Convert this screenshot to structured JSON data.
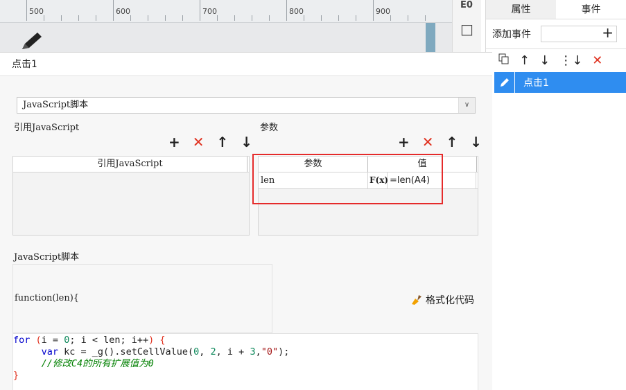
{
  "ruler": {
    "labels": [
      "500",
      "600",
      "700",
      "800",
      "900"
    ]
  },
  "toolbar_right": {
    "e_icon": "E0",
    "square_icon": "□"
  },
  "right_panel": {
    "tabs": [
      "属性",
      "事件"
    ],
    "add_event_label": "添加事件",
    "add_symbol": "+",
    "toolbar": [
      "copy-icon",
      "arrow-up-icon",
      "arrow-down-icon",
      "sort-icon",
      "delete-icon"
    ],
    "event_item": "点击1"
  },
  "dialog": {
    "title": "点击1",
    "type_select": "JavaScript脚本",
    "ref_section": "引用JavaScript",
    "param_section": "参数",
    "ref_table": {
      "header": "引用JavaScript"
    },
    "param_table": {
      "headers": [
        "参数",
        "值"
      ],
      "rows": [
        {
          "name": "len",
          "fx": "F(x)",
          "value": "=len(A4)"
        }
      ]
    },
    "js_section": "JavaScript脚本",
    "function_sig": "function(len){",
    "format_button": "格式化代码",
    "code_lines": [
      "for (i = 0; i < len; i++) {",
      "     var kc = _g().setCellValue(0, 2, i + 3,\"0\");",
      "     //修改C4的所有扩展值为0",
      "}"
    ]
  },
  "colors": {
    "accent_blue": "#2f8df0",
    "delete_red": "#e0301e",
    "highlight_red": "#e52b2b"
  }
}
